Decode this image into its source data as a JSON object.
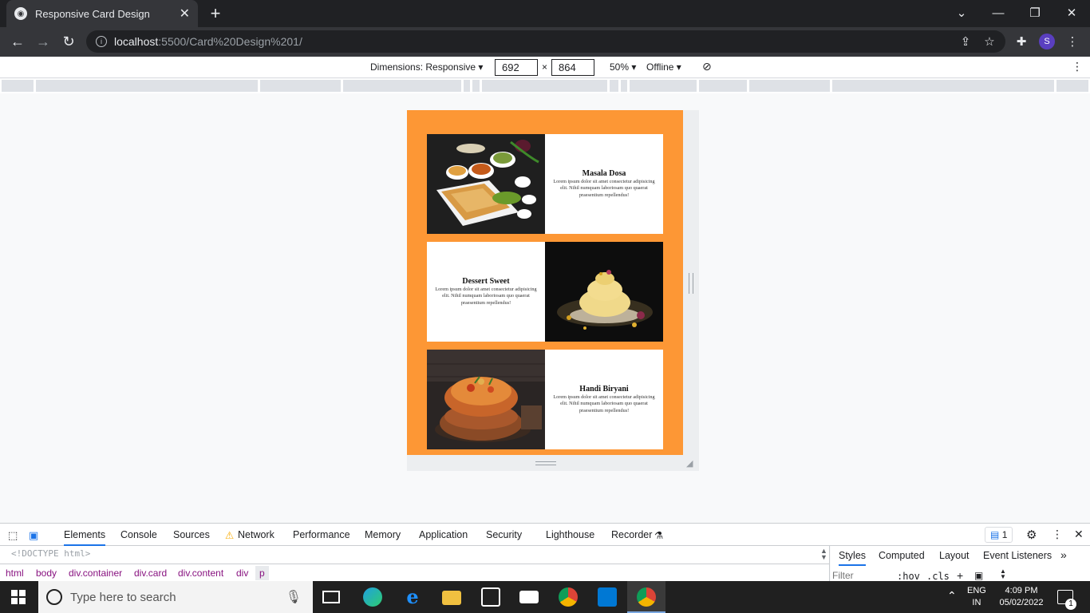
{
  "browser": {
    "tab_title": "Responsive Card Design",
    "url_host": "localhost",
    "url_path": ":5500/Card%20Design%201/"
  },
  "device_toolbar": {
    "dimensions_label": "Dimensions: Responsive",
    "width": "692",
    "height": "864",
    "times": "×",
    "zoom": "50%",
    "network": "Offline"
  },
  "page": {
    "accent_color": "#fd9735",
    "cards": [
      {
        "title": "Masala Dosa",
        "text": "Lorem ipsum dolor sit amet consectetur adipisicing elit. Nihil numquam laboriosam quo quaerat praesentium repellendus!"
      },
      {
        "title": "Dessert Sweet",
        "text": "Lorem ipsum dolor sit amet consectetur adipisicing elit. Nihil numquam laboriosam quo quaerat praesentium repellendus!"
      },
      {
        "title": "Handi Biryani",
        "text": "Lorem ipsum dolor sit amet consectetur adipisicing elit. Nihil numquam laboriosam quo quaerat praesentium repellendus!"
      }
    ]
  },
  "devtools": {
    "tabs": [
      "Elements",
      "Console",
      "Sources",
      "Network",
      "Performance",
      "Memory",
      "Application",
      "Security",
      "Lighthouse",
      "Recorder"
    ],
    "issues_count": "1",
    "doctype": "<!DOCTYPE html>",
    "breadcrumbs": [
      "html",
      "body",
      "div.container",
      "div.card",
      "div.content",
      "div",
      "p"
    ],
    "side_tabs": [
      "Styles",
      "Computed",
      "Layout",
      "Event Listeners"
    ],
    "filter_placeholder": "Filter",
    "hov": ":hov",
    "cls": ".cls"
  },
  "taskbar": {
    "search_placeholder": "Type here to search",
    "lang1": "ENG",
    "lang2": "IN",
    "time": "4:09 PM",
    "date": "05/02/2022",
    "notif_count": "1"
  }
}
